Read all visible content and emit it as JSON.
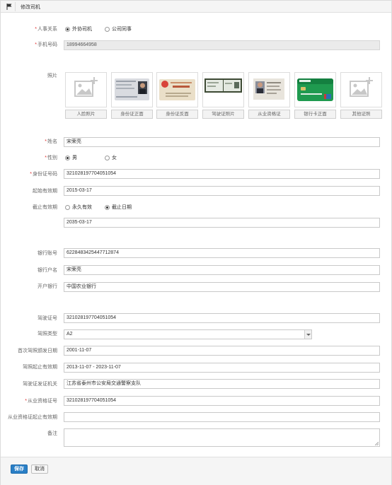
{
  "window": {
    "title": "修改司机"
  },
  "fields": {
    "relation": {
      "label": "人事关系",
      "options": [
        "外协司机",
        "公司同事"
      ],
      "selected": 0
    },
    "phone": {
      "label": "手机号码",
      "value": "18994664958"
    },
    "photos": {
      "label": "照片",
      "items": [
        "人脸照片",
        "身份证正面",
        "身份证反面",
        "驾驶证照片",
        "从业资格证",
        "银行卡正面",
        "其他证照"
      ]
    },
    "name": {
      "label": "姓名",
      "value": "宋荣亮"
    },
    "gender": {
      "label": "性别",
      "options": [
        "男",
        "女"
      ],
      "selected": 0
    },
    "id_number": {
      "label": "身份证号码",
      "value": "321028197704051054"
    },
    "valid_from": {
      "label": "起始有效期",
      "value": "2015-03-17"
    },
    "valid_to": {
      "label": "截止有效期",
      "options": [
        "永久有效",
        "截止日期"
      ],
      "selected": 1,
      "value": "2035-03-17"
    },
    "bank_account": {
      "label": "银行账号",
      "value": "6228483425447712874"
    },
    "account_name": {
      "label": "银行户名",
      "value": "宋荣亮"
    },
    "bank": {
      "label": "开户银行",
      "value": "中国农业银行"
    },
    "license_no": {
      "label": "驾驶证号",
      "value": "321028197704051054"
    },
    "license_type": {
      "label": "驾照类型",
      "value": "A2"
    },
    "first_issue": {
      "label": "首次驾照颁发日期",
      "value": "2001-11-07"
    },
    "license_valid": {
      "label": "驾照起止有效期",
      "value": "2013-11-07 - 2023-11-07"
    },
    "license_issuer": {
      "label": "驾驶证发证机关",
      "value": "江苏省泰州市公安局交通警察支队"
    },
    "qualification_no": {
      "label": "从业资格证号",
      "value": "321028197704051054"
    },
    "qualification_valid": {
      "label": "从业资格证起止有效期",
      "value": ""
    },
    "remark": {
      "label": "备注",
      "value": ""
    }
  },
  "buttons": {
    "save": "保存",
    "cancel": "取消"
  },
  "colors": {
    "primary": "#2a7fc6",
    "required": "#e0302e"
  }
}
